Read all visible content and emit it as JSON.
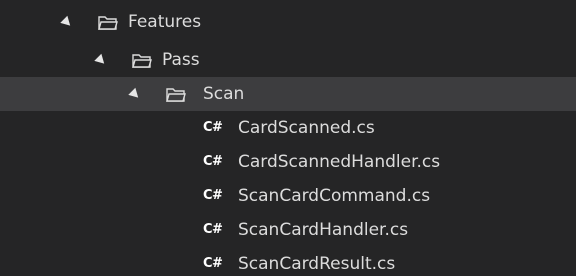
{
  "tree": {
    "nodes": [
      {
        "label": "Features",
        "type": "folder",
        "expanded": true
      },
      {
        "label": "Pass",
        "type": "folder",
        "expanded": true
      },
      {
        "label": "Scan",
        "type": "folder",
        "expanded": true,
        "selected": true
      },
      {
        "label": "CardScanned.cs",
        "type": "csharp-file"
      },
      {
        "label": "CardScannedHandler.cs",
        "type": "csharp-file"
      },
      {
        "label": "ScanCardCommand.cs",
        "type": "csharp-file"
      },
      {
        "label": "ScanCardHandler.cs",
        "type": "csharp-file"
      },
      {
        "label": "ScanCardResult.cs",
        "type": "csharp-file"
      }
    ],
    "cs_icon_text": "C#"
  },
  "colors": {
    "background": "#252526",
    "selected_row": "#3d3d3f",
    "text": "#dcdcdc"
  }
}
